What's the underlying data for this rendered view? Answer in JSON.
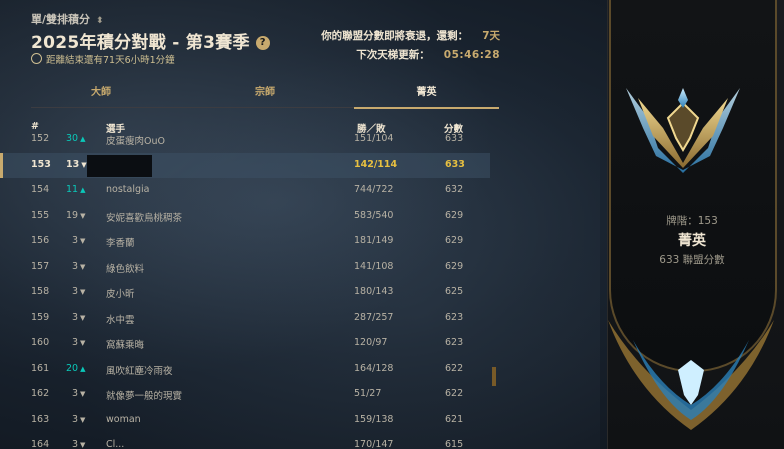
{
  "header": {
    "queue_label": "單/雙排積分",
    "title": "2025年積分對戰 - 第3賽季",
    "season_remaining": "距離結束還有71天6小時1分鐘",
    "decay_label": "你的聯盟分數即將衰退，還剩：",
    "decay_value": "7天",
    "ladder_label": "下次天梯更新：",
    "ladder_value": "05:46:28"
  },
  "tabs": [
    {
      "label": "大師",
      "active": false
    },
    {
      "label": "宗師",
      "active": false
    },
    {
      "label": "菁英",
      "active": true
    }
  ],
  "columns": {
    "rank": "#",
    "player": "選手",
    "record": "勝／敗",
    "points": "分數"
  },
  "rows": [
    {
      "rank": "152",
      "change": "30",
      "up": true,
      "name": "皮蛋瘦肉OuO",
      "record": "151/104",
      "points": "633"
    },
    {
      "rank": "153",
      "change": "13",
      "up": false,
      "name": "",
      "record": "142/114",
      "points": "633",
      "highlighted": true
    },
    {
      "rank": "154",
      "change": "11",
      "up": true,
      "name": "nostalgia",
      "record": "744/722",
      "points": "632"
    },
    {
      "rank": "155",
      "change": "19",
      "up": false,
      "name": "安妮喜歡烏桃稠茶",
      "record": "583/540",
      "points": "629"
    },
    {
      "rank": "156",
      "change": "3",
      "up": false,
      "name": "李香蘭",
      "record": "181/149",
      "points": "629"
    },
    {
      "rank": "157",
      "change": "3",
      "up": false,
      "name": "綠色飲料",
      "record": "141/108",
      "points": "629"
    },
    {
      "rank": "158",
      "change": "3",
      "up": false,
      "name": "皮小昕",
      "record": "180/143",
      "points": "625"
    },
    {
      "rank": "159",
      "change": "3",
      "up": false,
      "name": "水中雲",
      "record": "287/257",
      "points": "623"
    },
    {
      "rank": "160",
      "change": "3",
      "up": false,
      "name": "窩蘇乘晦",
      "record": "120/97",
      "points": "623"
    },
    {
      "rank": "161",
      "change": "20",
      "up": true,
      "name": "風吹紅塵冷雨夜",
      "record": "164/128",
      "points": "622"
    },
    {
      "rank": "162",
      "change": "3",
      "up": false,
      "name": "就像夢一般的現實",
      "record": "51/27",
      "points": "622"
    },
    {
      "rank": "163",
      "change": "3",
      "up": false,
      "name": "woman",
      "record": "159/138",
      "points": "621"
    },
    {
      "rank": "164",
      "change": "3",
      "up": false,
      "name": "Cl...",
      "record": "170/147",
      "points": "615"
    }
  ],
  "profile": {
    "tier_rank_label": "牌階：153",
    "tier_name": "菁英",
    "lp_label": "633 聯盟分數"
  },
  "colors": {
    "gold": "#c8aa6e",
    "teal_up": "#0ac8b9",
    "highlight_points": "#e8c040"
  }
}
